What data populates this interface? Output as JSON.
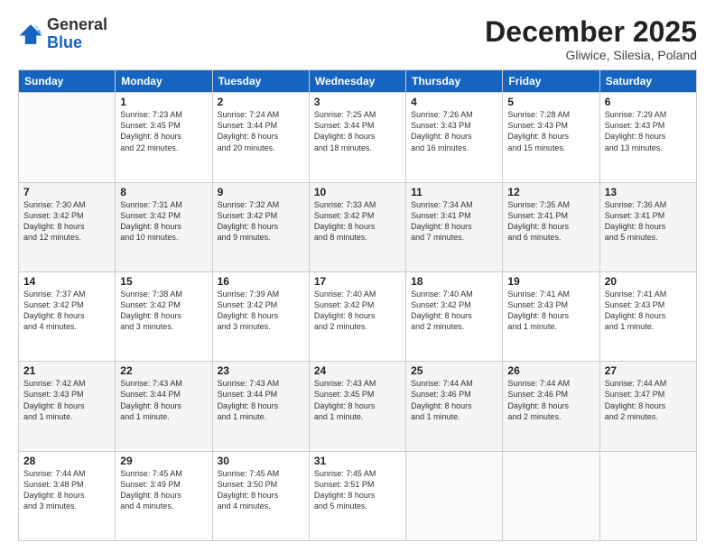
{
  "logo": {
    "general": "General",
    "blue": "Blue"
  },
  "header": {
    "month": "December 2025",
    "location": "Gliwice, Silesia, Poland"
  },
  "days": [
    "Sunday",
    "Monday",
    "Tuesday",
    "Wednesday",
    "Thursday",
    "Friday",
    "Saturday"
  ],
  "weeks": [
    [
      {
        "num": "",
        "info": ""
      },
      {
        "num": "1",
        "info": "Sunrise: 7:23 AM\nSunset: 3:45 PM\nDaylight: 8 hours\nand 22 minutes."
      },
      {
        "num": "2",
        "info": "Sunrise: 7:24 AM\nSunset: 3:44 PM\nDaylight: 8 hours\nand 20 minutes."
      },
      {
        "num": "3",
        "info": "Sunrise: 7:25 AM\nSunset: 3:44 PM\nDaylight: 8 hours\nand 18 minutes."
      },
      {
        "num": "4",
        "info": "Sunrise: 7:26 AM\nSunset: 3:43 PM\nDaylight: 8 hours\nand 16 minutes."
      },
      {
        "num": "5",
        "info": "Sunrise: 7:28 AM\nSunset: 3:43 PM\nDaylight: 8 hours\nand 15 minutes."
      },
      {
        "num": "6",
        "info": "Sunrise: 7:29 AM\nSunset: 3:43 PM\nDaylight: 8 hours\nand 13 minutes."
      }
    ],
    [
      {
        "num": "7",
        "info": "Sunrise: 7:30 AM\nSunset: 3:42 PM\nDaylight: 8 hours\nand 12 minutes."
      },
      {
        "num": "8",
        "info": "Sunrise: 7:31 AM\nSunset: 3:42 PM\nDaylight: 8 hours\nand 10 minutes."
      },
      {
        "num": "9",
        "info": "Sunrise: 7:32 AM\nSunset: 3:42 PM\nDaylight: 8 hours\nand 9 minutes."
      },
      {
        "num": "10",
        "info": "Sunrise: 7:33 AM\nSunset: 3:42 PM\nDaylight: 8 hours\nand 8 minutes."
      },
      {
        "num": "11",
        "info": "Sunrise: 7:34 AM\nSunset: 3:41 PM\nDaylight: 8 hours\nand 7 minutes."
      },
      {
        "num": "12",
        "info": "Sunrise: 7:35 AM\nSunset: 3:41 PM\nDaylight: 8 hours\nand 6 minutes."
      },
      {
        "num": "13",
        "info": "Sunrise: 7:36 AM\nSunset: 3:41 PM\nDaylight: 8 hours\nand 5 minutes."
      }
    ],
    [
      {
        "num": "14",
        "info": "Sunrise: 7:37 AM\nSunset: 3:42 PM\nDaylight: 8 hours\nand 4 minutes."
      },
      {
        "num": "15",
        "info": "Sunrise: 7:38 AM\nSunset: 3:42 PM\nDaylight: 8 hours\nand 3 minutes."
      },
      {
        "num": "16",
        "info": "Sunrise: 7:39 AM\nSunset: 3:42 PM\nDaylight: 8 hours\nand 3 minutes."
      },
      {
        "num": "17",
        "info": "Sunrise: 7:40 AM\nSunset: 3:42 PM\nDaylight: 8 hours\nand 2 minutes."
      },
      {
        "num": "18",
        "info": "Sunrise: 7:40 AM\nSunset: 3:42 PM\nDaylight: 8 hours\nand 2 minutes."
      },
      {
        "num": "19",
        "info": "Sunrise: 7:41 AM\nSunset: 3:43 PM\nDaylight: 8 hours\nand 1 minute."
      },
      {
        "num": "20",
        "info": "Sunrise: 7:41 AM\nSunset: 3:43 PM\nDaylight: 8 hours\nand 1 minute."
      }
    ],
    [
      {
        "num": "21",
        "info": "Sunrise: 7:42 AM\nSunset: 3:43 PM\nDaylight: 8 hours\nand 1 minute."
      },
      {
        "num": "22",
        "info": "Sunrise: 7:43 AM\nSunset: 3:44 PM\nDaylight: 8 hours\nand 1 minute."
      },
      {
        "num": "23",
        "info": "Sunrise: 7:43 AM\nSunset: 3:44 PM\nDaylight: 8 hours\nand 1 minute."
      },
      {
        "num": "24",
        "info": "Sunrise: 7:43 AM\nSunset: 3:45 PM\nDaylight: 8 hours\nand 1 minute."
      },
      {
        "num": "25",
        "info": "Sunrise: 7:44 AM\nSunset: 3:46 PM\nDaylight: 8 hours\nand 1 minute."
      },
      {
        "num": "26",
        "info": "Sunrise: 7:44 AM\nSunset: 3:46 PM\nDaylight: 8 hours\nand 2 minutes."
      },
      {
        "num": "27",
        "info": "Sunrise: 7:44 AM\nSunset: 3:47 PM\nDaylight: 8 hours\nand 2 minutes."
      }
    ],
    [
      {
        "num": "28",
        "info": "Sunrise: 7:44 AM\nSunset: 3:48 PM\nDaylight: 8 hours\nand 3 minutes."
      },
      {
        "num": "29",
        "info": "Sunrise: 7:45 AM\nSunset: 3:49 PM\nDaylight: 8 hours\nand 4 minutes."
      },
      {
        "num": "30",
        "info": "Sunrise: 7:45 AM\nSunset: 3:50 PM\nDaylight: 8 hours\nand 4 minutes."
      },
      {
        "num": "31",
        "info": "Sunrise: 7:45 AM\nSunset: 3:51 PM\nDaylight: 8 hours\nand 5 minutes."
      },
      {
        "num": "",
        "info": ""
      },
      {
        "num": "",
        "info": ""
      },
      {
        "num": "",
        "info": ""
      }
    ]
  ]
}
